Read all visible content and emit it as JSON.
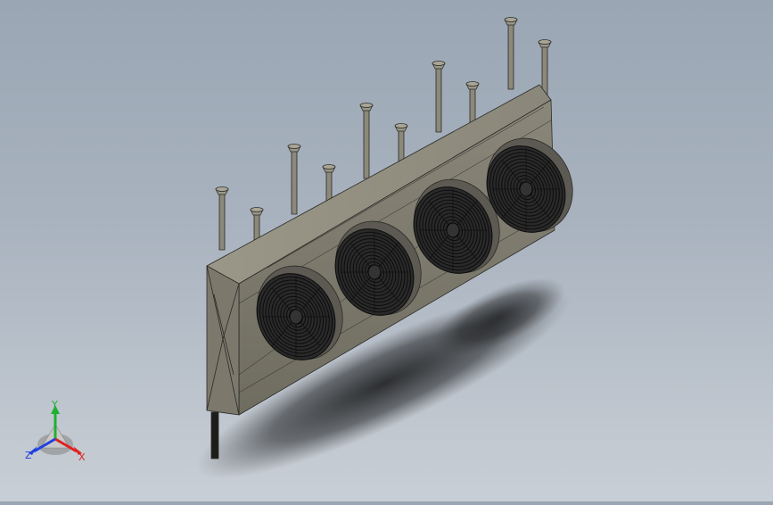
{
  "viewport": {
    "background_top": "#9aa6b4",
    "background_bottom": "#c9cfd6",
    "model": {
      "fan_count": 4,
      "hanger_rod_count": 10,
      "housing_color": "#807d70",
      "fan_color": "#2a2a2a"
    }
  },
  "triad": {
    "x_label": "X",
    "y_label": "Y",
    "z_label": "Z",
    "x_color": "#e02020",
    "y_color": "#20b030",
    "z_color": "#2040e0"
  }
}
